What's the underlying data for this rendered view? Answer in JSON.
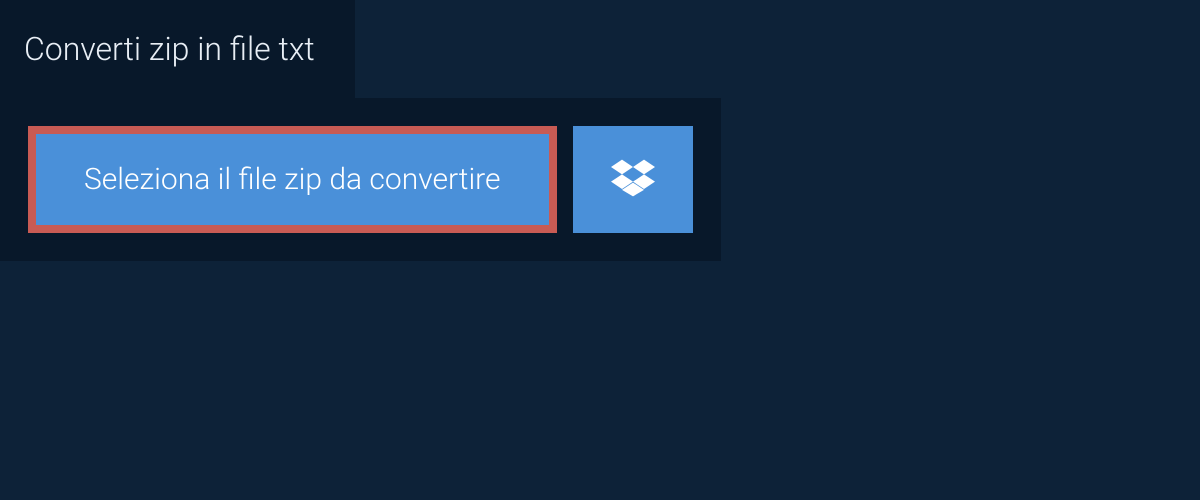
{
  "tab": {
    "title": "Converti zip in file txt"
  },
  "upload": {
    "select_file_label": "Seleziona il file zip da convertire"
  },
  "colors": {
    "background": "#0d2238",
    "panel": "#08182a",
    "button": "#4a90d9",
    "highlight_border": "#c85b54",
    "text": "#ffffff"
  }
}
